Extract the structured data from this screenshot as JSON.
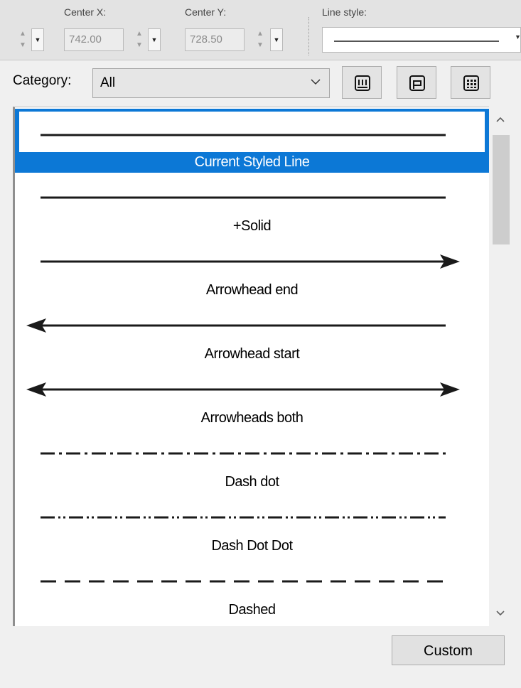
{
  "toolbar": {
    "center_x_label": "Center X:",
    "center_x_value": "742.00",
    "center_y_label": "Center Y:",
    "center_y_value": "728.50",
    "line_style_label": "Line style:"
  },
  "category": {
    "label": "Category:",
    "selected": "All"
  },
  "line_styles": [
    {
      "name": "Current Styled Line",
      "selected": true
    },
    {
      "name": "+Solid",
      "selected": false
    },
    {
      "name": "Arrowhead end",
      "selected": false
    },
    {
      "name": "Arrowhead start",
      "selected": false
    },
    {
      "name": "Arrowheads both",
      "selected": false
    },
    {
      "name": "Dash dot",
      "selected": false
    },
    {
      "name": "Dash Dot Dot",
      "selected": false
    },
    {
      "name": "Dashed",
      "selected": false
    }
  ],
  "buttons": {
    "custom": "Custom"
  },
  "colors": {
    "selection": "#0c78d6",
    "line": "#1a1a1a"
  }
}
